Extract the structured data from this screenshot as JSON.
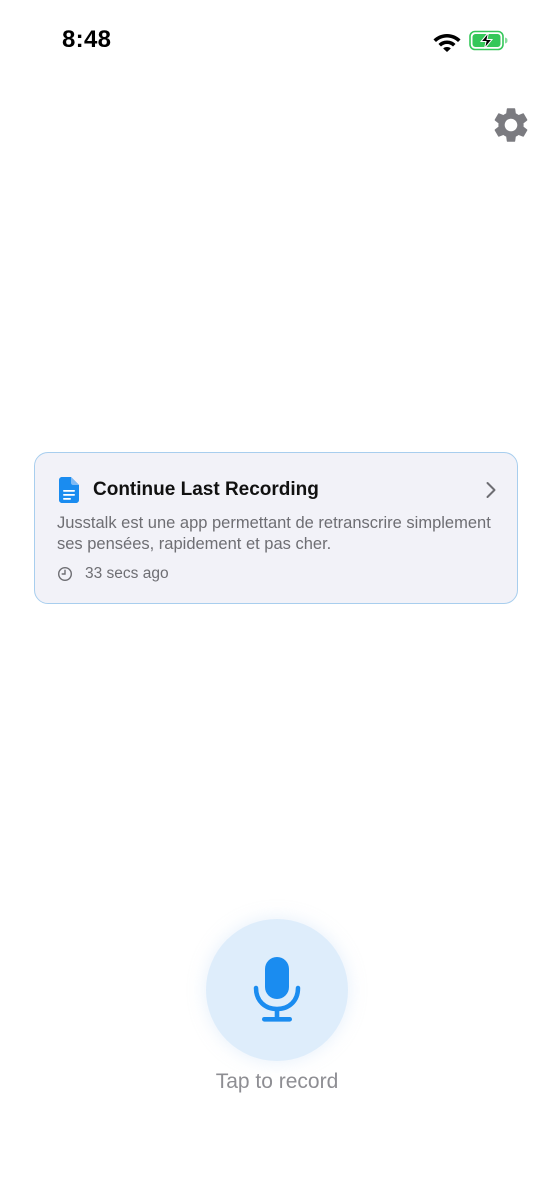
{
  "status_bar": {
    "time": "8:48",
    "icons": [
      "wifi-icon",
      "battery-charging-icon"
    ]
  },
  "header": {
    "settings_icon": "gear-icon"
  },
  "last_recording": {
    "title": "Continue Last Recording",
    "preview": "Jusstalk est une app permettant de retranscrire simplement ses pensées, rapidement et pas cher.",
    "time_ago": "33 secs ago",
    "icon": "document-icon"
  },
  "recorder": {
    "label": "Tap to record",
    "icon": "microphone-icon"
  },
  "colors": {
    "accent": "#1a8cf0",
    "card_background": "#f2f2f8",
    "card_border": "#a8ceee",
    "record_button_background": "#deedfb",
    "secondary_text": "#6e6e73",
    "gear": "#7b7b80",
    "battery_fill": "#34c759"
  }
}
